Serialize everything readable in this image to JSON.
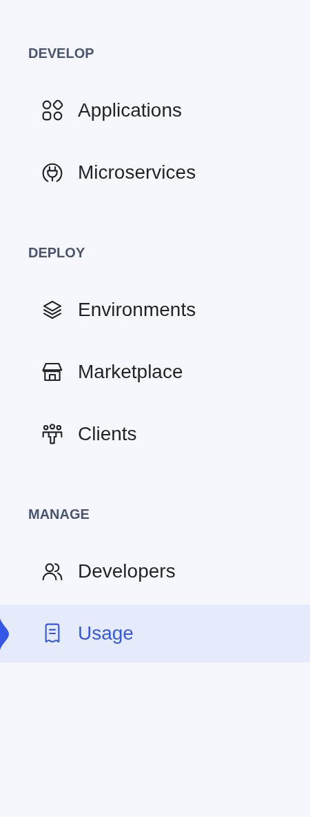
{
  "sections": [
    {
      "title": "DEVELOP",
      "items": [
        {
          "label": "Applications",
          "selected": false
        },
        {
          "label": "Microservices",
          "selected": false
        }
      ]
    },
    {
      "title": "DEPLOY",
      "items": [
        {
          "label": "Environments",
          "selected": false
        },
        {
          "label": "Marketplace",
          "selected": false
        },
        {
          "label": "Clients",
          "selected": false
        }
      ]
    },
    {
      "title": "MANAGE",
      "items": [
        {
          "label": "Developers",
          "selected": false
        },
        {
          "label": "Usage",
          "selected": true
        }
      ]
    }
  ]
}
